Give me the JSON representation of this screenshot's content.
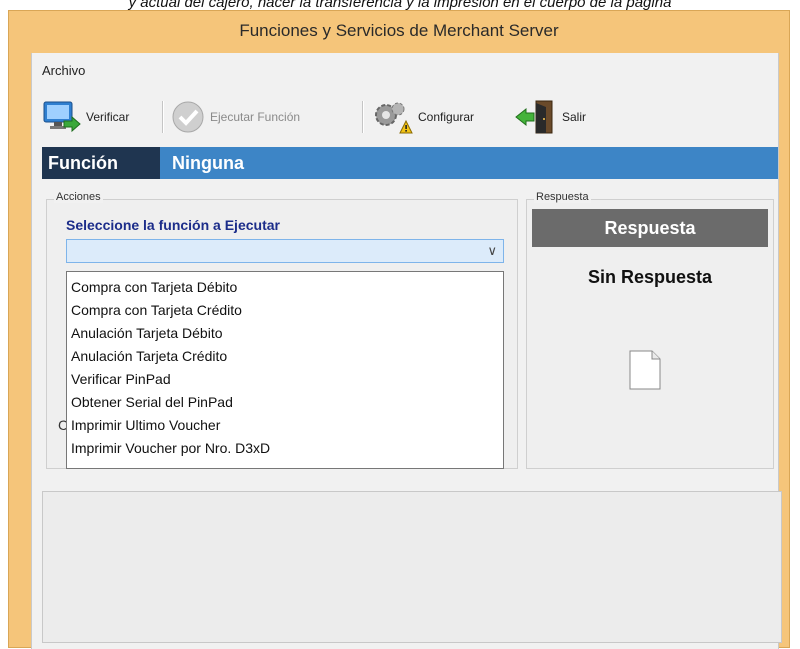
{
  "caption": "y actual del cajero, hacer la transferencia y la impresión en el cuerpo de la pagina",
  "window": {
    "title": "Funciones y Servicios de Merchant Server"
  },
  "menubar": {
    "items": [
      "Archivo"
    ]
  },
  "toolbar": {
    "verify_label": "Verificar",
    "execute_label": "Ejecutar Función",
    "configure_label": "Configurar",
    "exit_label": "Salir"
  },
  "function_bar": {
    "label": "Función",
    "value": "Ninguna"
  },
  "actions": {
    "group_label": "Acciones",
    "select_label": "Seleccione la función a Ejecutar",
    "combo_value": "",
    "options": [
      "Compra con Tarjeta Débito",
      "Compra con Tarjeta Crédito",
      "Anulación Tarjeta Débito",
      "Anulación Tarjeta Crédito",
      "Verificar PinPad",
      "Obtener Serial del PinPad",
      "Imprimir Ultimo Voucher",
      "Imprimir Voucher por Nro. D3xD"
    ]
  },
  "response": {
    "group_label": "Respuesta",
    "header": "Respuesta",
    "text": "Sin Respuesta"
  },
  "icons": {
    "verify": "monitor-check-icon",
    "execute": "checkmark-circle-icon",
    "configure": "gears-warning-icon",
    "exit": "door-exit-icon",
    "combo_arrow": "chevron-down-icon",
    "document": "document-icon"
  }
}
